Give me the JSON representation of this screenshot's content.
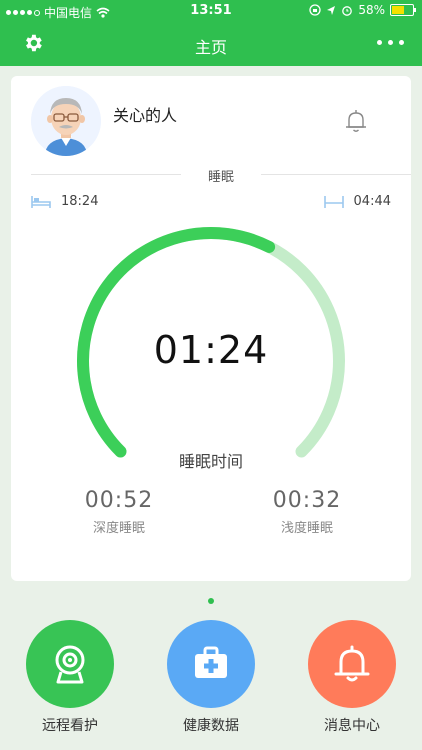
{
  "status_bar": {
    "carrier": "中国电信",
    "time": "13:51",
    "battery": "58%",
    "battery_level": 0.58
  },
  "header": {
    "title": "主页",
    "settings_icon": "gear-icon",
    "more_icon": "more-icon"
  },
  "card": {
    "person_name": "关心的人",
    "section_label": "睡眠",
    "bed_time": "18:24",
    "wake_time": "04:44",
    "sleep_duration": "01:24",
    "sleep_duration_label": "睡眠时间",
    "gauge_progress": 0.6,
    "deep_sleep": {
      "value": "00:52",
      "label": "深度睡眠"
    },
    "light_sleep": {
      "value": "00:32",
      "label": "浅度睡眠"
    }
  },
  "colors": {
    "brand_green": "#2fbf4f",
    "gauge_active": "#3ccf59",
    "gauge_track": "#c4ecc9",
    "blue": "#5aa9f5",
    "orange": "#ff7b5a"
  },
  "nav": [
    {
      "label": "远程看护",
      "icon": "camera-icon"
    },
    {
      "label": "健康数据",
      "icon": "medical-kit-icon"
    },
    {
      "label": "消息中心",
      "icon": "bell-icon"
    }
  ]
}
